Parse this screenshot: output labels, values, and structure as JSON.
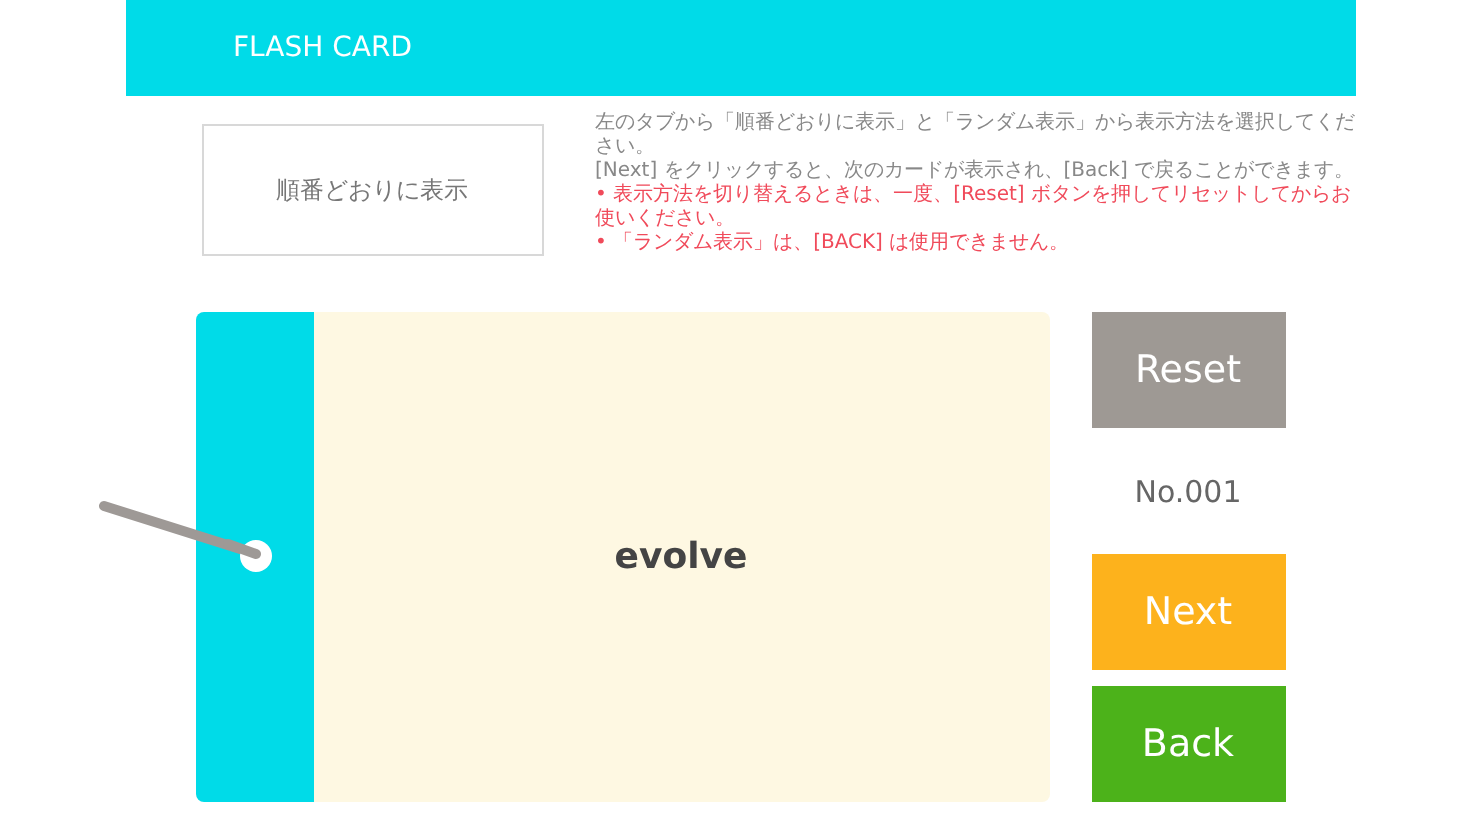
{
  "header": {
    "title": "FLASH CARD"
  },
  "mode_tab": {
    "label": "順番どおりに表示"
  },
  "instructions": [
    {
      "kind": "note",
      "text": "左のタブから「順番どおりに表示」と「ランダム表示」から表示方法を選択してください。"
    },
    {
      "kind": "note",
      "text": "[Next] をクリックすると、次のカードが表示され、[Back] で戻ることができます。"
    },
    {
      "kind": "warning",
      "text": "• 表示方法を切り替えるときは、一度、[Reset] ボタンを押してリセットしてからお使いください。"
    },
    {
      "kind": "warning",
      "text": "• 「ランダム表示」は、[BACK] は使用できません。"
    }
  ],
  "card": {
    "word": "evolve"
  },
  "controls": {
    "reset": "Reset",
    "number": "No.001",
    "next": "Next",
    "back": "Back"
  }
}
